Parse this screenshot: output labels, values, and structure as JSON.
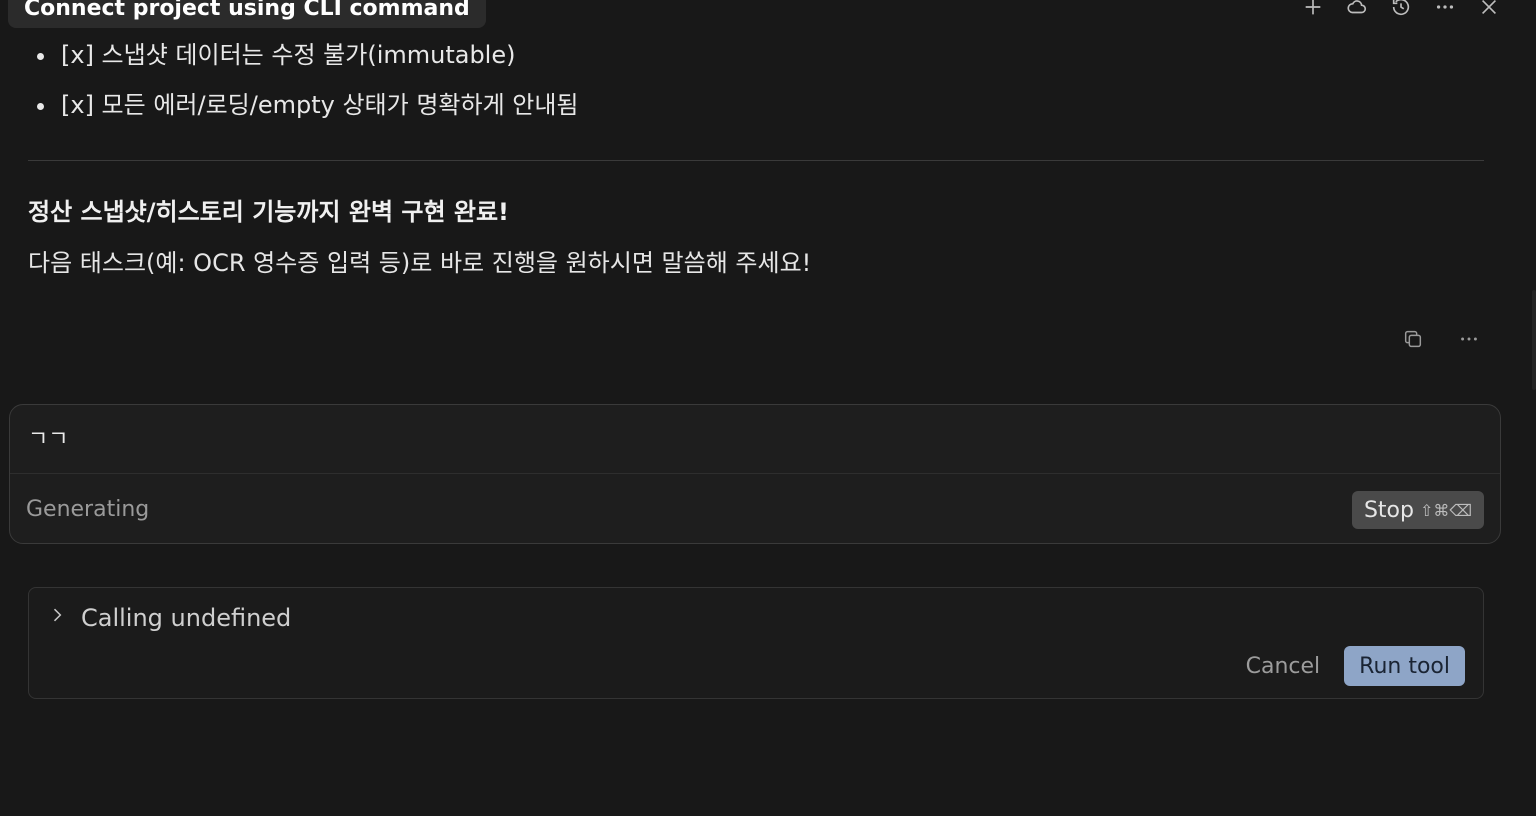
{
  "header": {
    "title": "Connect project using CLI command",
    "icons": [
      "plus-icon",
      "cloud-icon",
      "history-icon",
      "more-icon",
      "close-icon"
    ]
  },
  "message": {
    "checklist": [
      "[x] 스냅샷 데이터는 수정 불가(immutable)",
      "[x] 모든 에러/로딩/empty 상태가 명확하게 안내됨"
    ],
    "summary_bold": "정산 스냅샷/히스토리 기능까지 완벽 구현 완료!",
    "summary_text": "다음 태스크(예: OCR 영수증 입력 등)로 바로 진행을 원하시면 말씀해 주세요!",
    "actions": [
      "copy-icon",
      "more-icon"
    ]
  },
  "composer": {
    "input_value": "ㄱㄱ",
    "status": "Generating",
    "stop_label": "Stop",
    "stop_shortcut": "⇧⌘⌫"
  },
  "tool_call": {
    "label": "Calling undefined",
    "cancel_label": "Cancel",
    "run_label": "Run tool",
    "accent": "#8ea5c7"
  }
}
